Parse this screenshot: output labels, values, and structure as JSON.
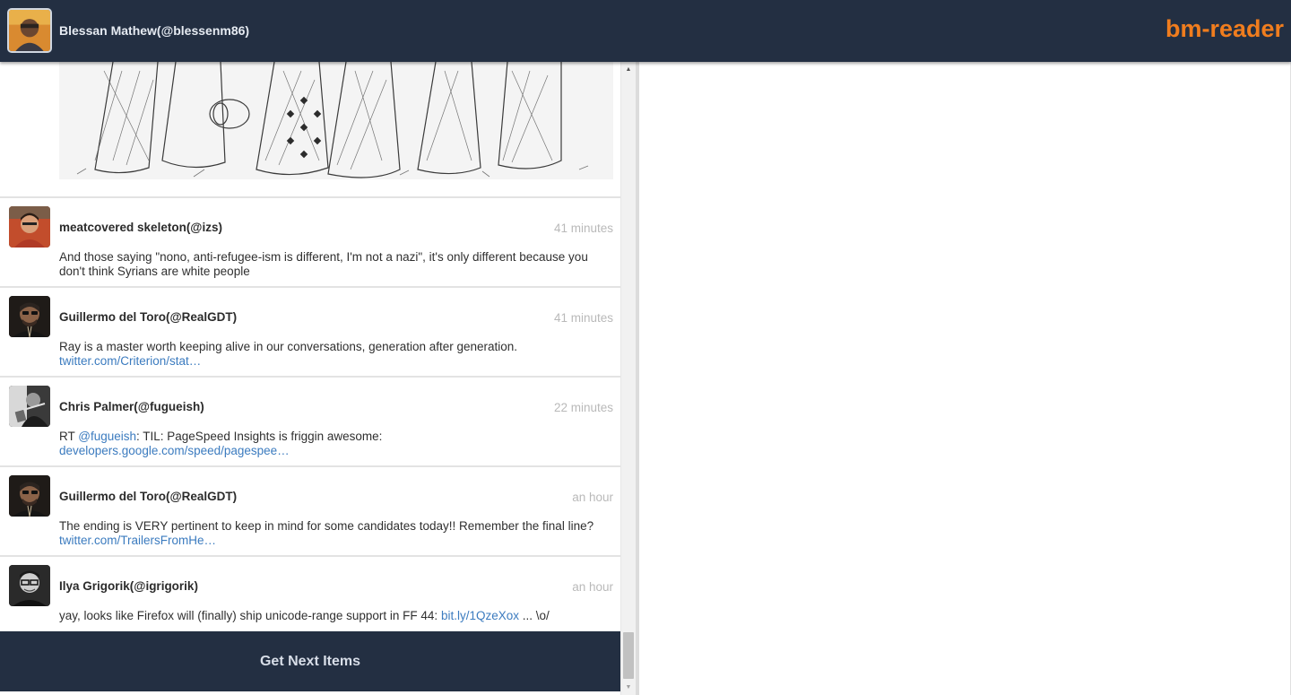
{
  "header": {
    "user_name": "Blessan Mathew(@blessenm86)",
    "brand": "bm-reader",
    "brand_color": "#f07d1e",
    "bar_color": "#232f42"
  },
  "feed": {
    "tweets": [
      {
        "author": "meatcovered skeleton(@izs)",
        "time": "41 minutes",
        "text": "And those saying \"nono, anti-refugee-ism is different, I'm not a nazi\", it's only different because you don't think Syrians are white people"
      },
      {
        "author": "Guillermo del Toro(@RealGDT)",
        "time": "41 minutes",
        "text": "Ray is a master worth keeping alive in our conversations, generation after generation.",
        "link": "twitter.com/Criterion/stat…"
      },
      {
        "author": "Chris Palmer(@fugueish)",
        "time": "22 minutes",
        "text_prefix": "RT ",
        "mention": "@fugueish",
        "text": ": TIL: PageSpeed Insights is friggin awesome:",
        "link": "developers.google.com/speed/pagespee…"
      },
      {
        "author": "Guillermo del Toro(@RealGDT)",
        "time": "an hour",
        "text": "The ending is VERY pertinent to keep in mind for some candidates today!! Remember the final line?",
        "link": "twitter.com/TrailersFromHe…"
      },
      {
        "author": "Ilya Grigorik(@igrigorik)",
        "time": "an hour",
        "text": "yay, looks like Firefox will (finally) ship unicode-range support in FF 44:",
        "link": "bit.ly/1QzeXox",
        "text_suffix": " ... \\o/"
      }
    ]
  },
  "pagination": {
    "next_label": "Get Next Items"
  },
  "icons": {
    "scroll_up": "▲",
    "scroll_down": "▼"
  }
}
